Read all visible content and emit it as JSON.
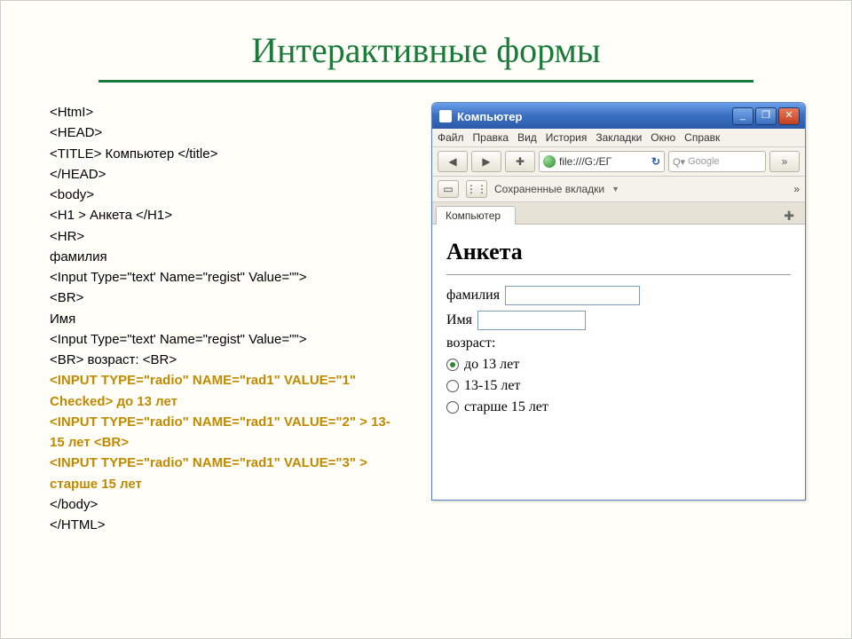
{
  "title": "Интерактивные формы",
  "code_lines": [
    {
      "text": "<HtmI>",
      "hl": false
    },
    {
      "text": "   <HEAD>",
      "hl": false
    },
    {
      "text": "      <TITLE> Компьютер </title>",
      "hl": false
    },
    {
      "text": "   </HEAD>",
      "hl": false
    },
    {
      "text": "   <body>",
      "hl": false
    },
    {
      "text": "<H1 > Анкета </H1>",
      "hl": false
    },
    {
      "text": "<HR>",
      "hl": false
    },
    {
      "text": "фамилия",
      "hl": false
    },
    {
      "text": "<Input Type=\"text' Name=\"regist\" Value=\"\">",
      "hl": false
    },
    {
      "text": "<BR>",
      "hl": false
    },
    {
      "text": "Имя",
      "hl": false
    },
    {
      "text": "<Input Type=\"text' Name=\"regist\" Value=\"\">",
      "hl": false
    },
    {
      "text": "<BR> возраст: <BR>",
      "hl": false
    },
    {
      "text": "<INPUT TYPE=\"radio\" NAME=\"rad1\" VALUE=\"1\" Checked> до 13 лет",
      "hl": true
    },
    {
      "text": "<INPUT TYPE=\"radio\" NAME=\"rad1\" VALUE=\"2\" > 13-15 лет <BR>",
      "hl": true
    },
    {
      "text": "<INPUT TYPE=\"radio\" NAME=\"rad1\" VALUE=\"3\" > старше 15 лет",
      "hl": true
    },
    {
      "text": "     </body>",
      "hl": false
    },
    {
      "text": "</HTML>",
      "hl": false
    }
  ],
  "browser": {
    "window_title": "Компьютер",
    "win_buttons": {
      "min": "_",
      "max": "❐",
      "close": "✕"
    },
    "menu": [
      "Файл",
      "Правка",
      "Вид",
      "История",
      "Закладки",
      "Окно",
      "Справк"
    ],
    "nav": {
      "back": "◀",
      "fwd": "▶",
      "plus": "✚",
      "reload": "↻",
      "overflow": "»"
    },
    "address": "file:///G:/ЕГ",
    "search_placeholder": "Google",
    "bookmarks_row": "Сохраненные вкладки",
    "bookmarks_arrow": "»",
    "tab_label": "Компьютер",
    "tab_plus": "✚",
    "page": {
      "heading": "Анкета",
      "surname_label": "фамилия",
      "name_label": "Имя",
      "age_label": "возраст:",
      "radios": [
        {
          "label": "до 13 лет",
          "checked": true
        },
        {
          "label": "13-15 лет",
          "checked": false
        },
        {
          "label": "старше 15 лет",
          "checked": false
        }
      ]
    }
  }
}
